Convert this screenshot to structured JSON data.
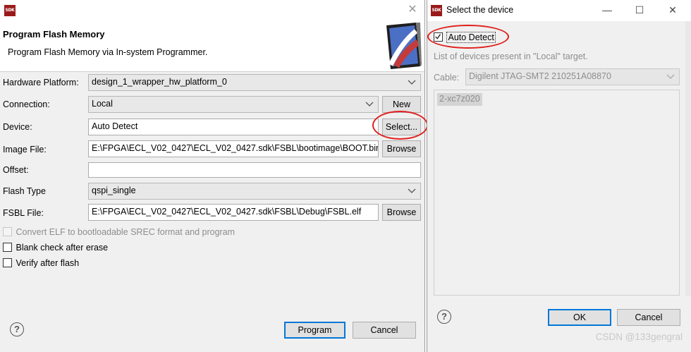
{
  "left_dialog": {
    "app_icon": "SDK",
    "header": {
      "title": "Program Flash Memory",
      "description": "Program Flash Memory via In-system Programmer."
    },
    "form": {
      "hardware_platform": {
        "label": "Hardware Platform:",
        "value": "design_1_wrapper_hw_platform_0"
      },
      "connection": {
        "label": "Connection:",
        "value": "Local",
        "button": "New"
      },
      "device": {
        "label": "Device:",
        "value": "Auto Detect",
        "button": "Select..."
      },
      "image_file": {
        "label": "Image File:",
        "value": "E:\\FPGA\\ECL_V02_0427\\ECL_V02_0427.sdk\\FSBL\\bootimage\\BOOT.bin",
        "button": "Browse"
      },
      "offset": {
        "label": "Offset:",
        "value": ""
      },
      "flash_type": {
        "label": "Flash Type",
        "value": "qspi_single"
      },
      "fsbl_file": {
        "label": "FSBL File:",
        "value": "E:\\FPGA\\ECL_V02_0427\\ECL_V02_0427.sdk\\FSBL\\Debug\\FSBL.elf",
        "button": "Browse"
      }
    },
    "options": {
      "convert_elf": "Convert ELF to bootloadable SREC format and program",
      "blank_check": "Blank check after erase",
      "verify": "Verify after flash"
    },
    "footer": {
      "help": "?",
      "program": "Program",
      "cancel": "Cancel"
    }
  },
  "right_dialog": {
    "app_icon": "SDK",
    "title": "Select the device",
    "auto_detect_label": "Auto Detect",
    "list_caption": "List of devices present in \"Local\" target.",
    "cable_label": "Cable:",
    "cable_value": "Digilent JTAG-SMT2 210251A08870",
    "devices": [
      "2-xc7z020"
    ],
    "footer": {
      "help": "?",
      "ok": "OK",
      "cancel": "Cancel"
    }
  },
  "watermark": "CSDN @133gengral",
  "colors": {
    "annotation_red": "#e0201c",
    "default_button_border": "#0078d7",
    "window_bg": "#f0f0f0"
  }
}
